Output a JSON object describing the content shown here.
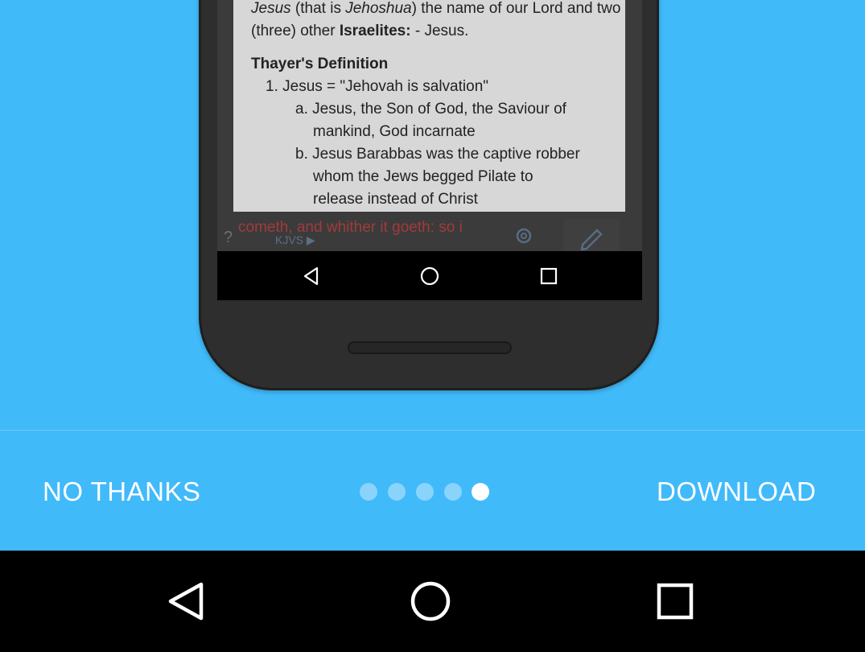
{
  "popup": {
    "intro_parts": [
      "Jesus",
      " (that is ",
      "Jehoshua",
      ") the name of our Lord and two (three) other ",
      "Israelites:",
      " - Jesus."
    ],
    "heading": "Thayer's Definition",
    "item_1": "1. Jesus = \"Jehovah is salvation\"",
    "item_a_1": "a. Jesus, the Son of God, the Saviour of",
    "item_a_2": "mankind, God incarnate",
    "item_b_1": "b. Jesus Barabbas was the captive robber",
    "item_b_2": "whom the Jews begged Pilate to",
    "item_b_3": "release instead of Christ"
  },
  "app_bar": {
    "verse_text": "cometh, and whither it goeth: so i",
    "help_icon": "?",
    "version_label": "KJVS ▶"
  },
  "onboarding": {
    "no_thanks_label": "NO THANKS",
    "download_label": "DOWNLOAD",
    "page_count": 5,
    "active_page": 5
  },
  "icons": {
    "back": "back-triangle-icon",
    "home": "home-circle-icon",
    "recents": "recents-square-icon",
    "settings": "gear-icon",
    "edit": "pencil-icon"
  },
  "colors": {
    "background": "#41bafa",
    "inactive_dot": "#8ad4fb",
    "active_dot": "#ffffff",
    "nav_bar": "#000000"
  }
}
